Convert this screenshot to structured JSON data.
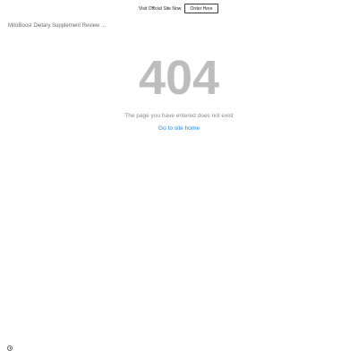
{
  "banner": {
    "text": "Visit Official Site Now",
    "button_label": "Order Here"
  },
  "header": {
    "site_title": "MitoBoost Dietary Supplement Review ..."
  },
  "error": {
    "code": "404",
    "message": "The page you have entered does not exist",
    "home_link": "Go to site home"
  },
  "footer": {
    "icon": "info-icon"
  },
  "colors": {
    "error_code": "#bdbdbd",
    "link": "#1e88e5"
  }
}
